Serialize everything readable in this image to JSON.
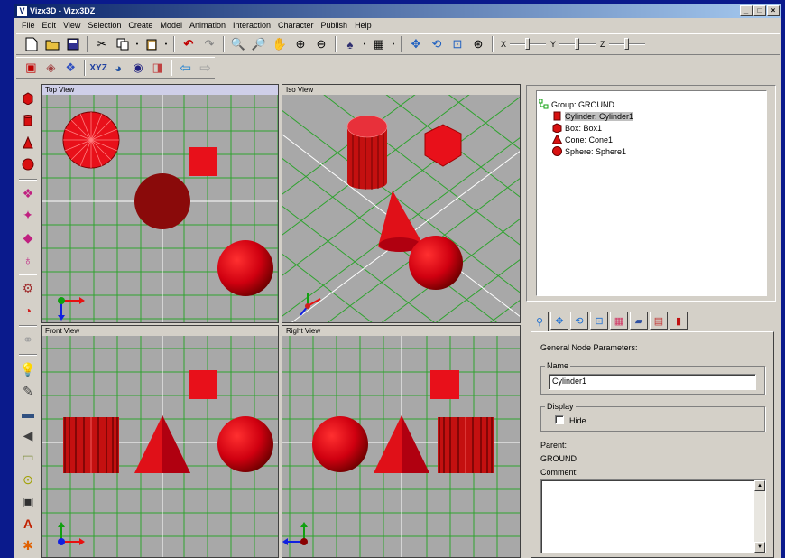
{
  "window": {
    "title": "Vizx3D - Vizx3DZ",
    "logo": "V",
    "buttons": [
      "_",
      "□",
      "×"
    ]
  },
  "menu": [
    "File",
    "Edit",
    "View",
    "Selection",
    "Create",
    "Model",
    "Animation",
    "Interaction",
    "Character",
    "Publish",
    "Help"
  ],
  "toolbar": {
    "slider_x": "X",
    "slider_y": "Y",
    "slider_z": "Z"
  },
  "viewports": {
    "top": "Top View",
    "iso": "Iso View",
    "front": "Front View",
    "right": "Right View"
  },
  "scene_tree": [
    {
      "label": "Group:  GROUND",
      "icon": "group-icon",
      "level": 0,
      "selected": false
    },
    {
      "label": "Cylinder:  Cylinder1",
      "icon": "cylinder-icon",
      "level": 1,
      "selected": true
    },
    {
      "label": "Box:  Box1",
      "icon": "box-icon",
      "level": 1,
      "selected": false
    },
    {
      "label": "Cone:  Cone1",
      "icon": "cone-icon",
      "level": 1,
      "selected": false
    },
    {
      "label": "Sphere:  Sphere1",
      "icon": "sphere-icon",
      "level": 1,
      "selected": false
    }
  ],
  "properties": {
    "heading": "General Node Parameters:",
    "name_label": "Name",
    "name_value": "Cylinder1",
    "display_label": "Display",
    "hide_label": "Hide",
    "parent_label": "Parent:",
    "parent_value": "GROUND",
    "comment_label": "Comment:"
  },
  "colors": {
    "accent": "#e8101a",
    "dark_red": "#7a0000",
    "grid": "#2fa32f",
    "viewport_bg": "#a8a8a8"
  }
}
